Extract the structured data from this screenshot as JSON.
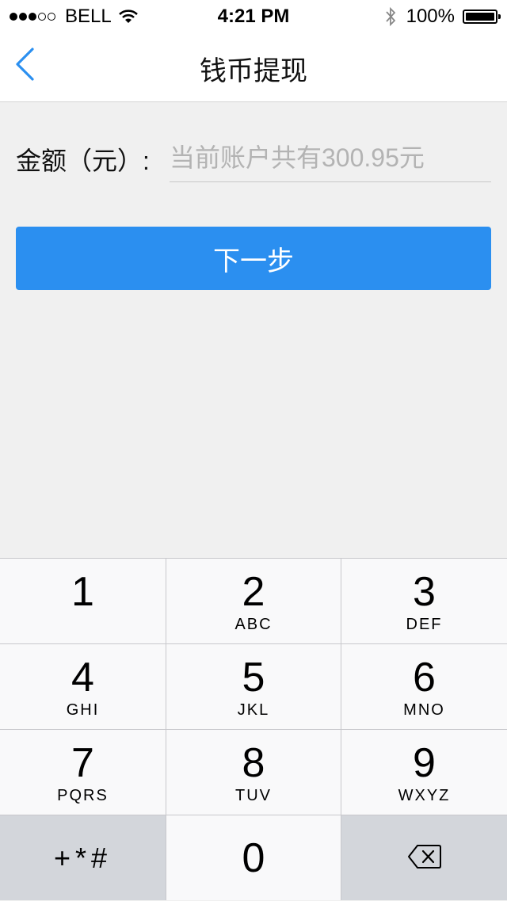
{
  "status_bar": {
    "signal_full": 3,
    "signal_empty": 2,
    "carrier": "BELL",
    "time": "4:21 PM",
    "battery_text": "100%",
    "battery_level": 1.0,
    "icons": [
      "wifi-icon",
      "bluetooth-icon",
      "battery-icon"
    ]
  },
  "nav": {
    "title": "钱币提现",
    "back_icon": "chevron-left-icon",
    "accent_color": "#2b8ff0"
  },
  "form": {
    "amount_label": "金额（元）:",
    "amount_value": "",
    "amount_placeholder": "当前账户共有300.95元"
  },
  "button": {
    "next_label": "下一步",
    "color": "#2b8ff0"
  },
  "keypad": {
    "keys": [
      {
        "digit": "1",
        "letters": ""
      },
      {
        "digit": "2",
        "letters": "ABC"
      },
      {
        "digit": "3",
        "letters": "DEF"
      },
      {
        "digit": "4",
        "letters": "GHI"
      },
      {
        "digit": "5",
        "letters": "JKL"
      },
      {
        "digit": "6",
        "letters": "MNO"
      },
      {
        "digit": "7",
        "letters": "PQRS"
      },
      {
        "digit": "8",
        "letters": "TUV"
      },
      {
        "digit": "9",
        "letters": "WXYZ"
      }
    ],
    "symbols_label": "+*#",
    "zero": "0",
    "delete_icon": "backspace-icon"
  }
}
